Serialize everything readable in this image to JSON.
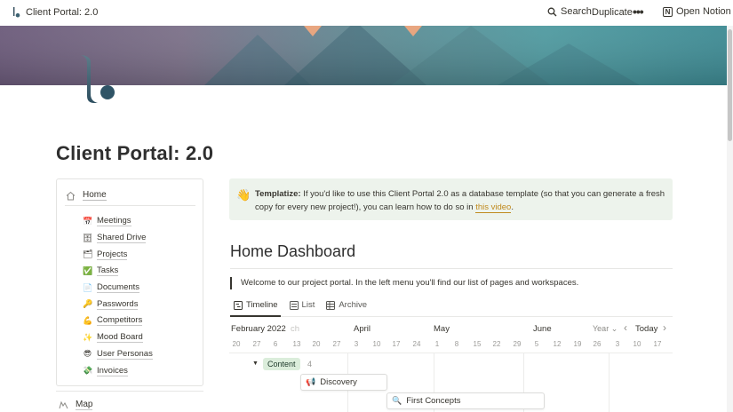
{
  "topbar": {
    "title": "Client Portal: 2.0",
    "search_label": "Search",
    "duplicate_label": "Duplicate",
    "more_label": "•••",
    "open_notion_label": "Open Notion",
    "notion_glyph": "N"
  },
  "page": {
    "title": "Client Portal: 2.0"
  },
  "sidebar": {
    "home_label": "Home",
    "items": [
      {
        "label": "Meetings",
        "icon": "calendar-icon",
        "glyph": "📅"
      },
      {
        "label": "Shared Drive",
        "icon": "drive-icon",
        "glyph": "🗄"
      },
      {
        "label": "Projects",
        "icon": "projects-icon",
        "glyph": "🗂"
      },
      {
        "label": "Tasks",
        "icon": "checkbox-icon",
        "glyph": "✅"
      },
      {
        "label": "Documents",
        "icon": "document-icon",
        "glyph": "📄"
      },
      {
        "label": "Passwords",
        "icon": "key-icon",
        "glyph": "🔑"
      },
      {
        "label": "Competitors",
        "icon": "flexed-arm-icon",
        "glyph": "💪"
      },
      {
        "label": "Mood Board",
        "icon": "sparkles-icon",
        "glyph": "✨"
      },
      {
        "label": "User Personas",
        "icon": "sunglasses-face-icon",
        "glyph": "😎"
      },
      {
        "label": "Invoices",
        "icon": "money-icon",
        "glyph": "💸"
      }
    ],
    "map_label": "Map"
  },
  "callout": {
    "emoji": "👋",
    "bold": "Templatize:",
    "text": " If you'd like to use this Client Portal 2.0 as a database template (so that you can generate a fresh copy for every new project!), you can learn how to do so in ",
    "link": "this video",
    "end": "."
  },
  "dashboard": {
    "heading": "Home Dashboard",
    "quote": "Welcome to our project portal. In the left menu you'll find our list of pages and workspaces."
  },
  "tabs": [
    {
      "label": "Timeline",
      "icon": "timeline-icon",
      "active": true
    },
    {
      "label": "List",
      "icon": "list-icon",
      "active": false
    },
    {
      "label": "Archive",
      "icon": "table-icon",
      "active": false
    }
  ],
  "timeline": {
    "current_month": "February 2022",
    "faded_month": "ch",
    "months": [
      "April",
      "May",
      "June"
    ],
    "scale_label": "Year",
    "scale_chevron": "⌄",
    "prev": "‹",
    "today_label": "Today",
    "next": "›",
    "days": [
      "20",
      "27",
      "6",
      "13",
      "20",
      "27",
      "3",
      "10",
      "17",
      "24",
      "1",
      "8",
      "15",
      "22",
      "29",
      "5",
      "12",
      "19",
      "26",
      "3",
      "10",
      "17"
    ],
    "group": {
      "label": "Content",
      "count": "4",
      "arrow": "▼"
    },
    "cards": [
      {
        "label": "Discovery",
        "icon": "megaphone-icon",
        "glyph": "📢"
      },
      {
        "label": "First Concepts",
        "icon": "magnifier-icon",
        "glyph": "🔍"
      }
    ]
  }
}
